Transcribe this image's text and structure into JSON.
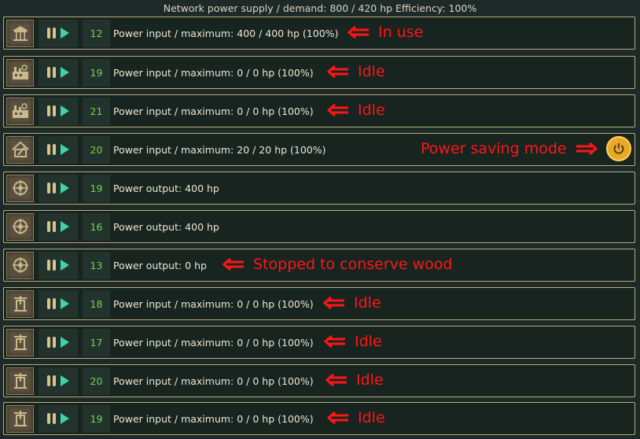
{
  "header": {
    "text": "Network power supply / demand: 800 / 420 hp Efficiency: 100%"
  },
  "colors": {
    "annotation": "#ff1616",
    "count": "#77d248",
    "play": "#3fd3a5",
    "pause": "#d8c48a",
    "border": "#b9ad7c",
    "power_button": "#e9a82a"
  },
  "rows": [
    {
      "icon": "carousel-icon",
      "count": "12",
      "status": "Power input / maximum: 400 / 400 hp (100%)",
      "note": "In use"
    },
    {
      "icon": "factory-icon",
      "count": "19",
      "status": "Power input / maximum: 0 / 0 hp (100%)",
      "note": "Idle"
    },
    {
      "icon": "factory-icon",
      "count": "21",
      "status": "Power input / maximum: 0 / 0 hp (100%)",
      "note": "Idle"
    },
    {
      "icon": "workshop-icon",
      "count": "20",
      "status": "Power input / maximum: 20 / 20 hp (100%)",
      "note": "Power saving mode"
    },
    {
      "icon": "power-plant-icon",
      "count": "19",
      "status": "Power output: 400 hp",
      "note": ""
    },
    {
      "icon": "power-plant-icon",
      "count": "16",
      "status": "Power output: 400 hp",
      "note": ""
    },
    {
      "icon": "power-plant-icon",
      "count": "13",
      "status": "Power output: 0 hp",
      "note": "Stopped to conserve wood"
    },
    {
      "icon": "water-pump-icon",
      "count": "18",
      "status": "Power input / maximum: 0 / 0 hp (100%)",
      "note": "Idle"
    },
    {
      "icon": "water-pump-icon",
      "count": "17",
      "status": "Power input / maximum: 0 / 0 hp (100%)",
      "note": "Idle"
    },
    {
      "icon": "water-pump-icon",
      "count": "20",
      "status": "Power input / maximum: 0 / 0 hp (100%)",
      "note": "Idle"
    },
    {
      "icon": "water-pump-icon",
      "count": "19",
      "status": "Power input / maximum: 0 / 0 hp (100%)",
      "note": "Idle"
    }
  ]
}
